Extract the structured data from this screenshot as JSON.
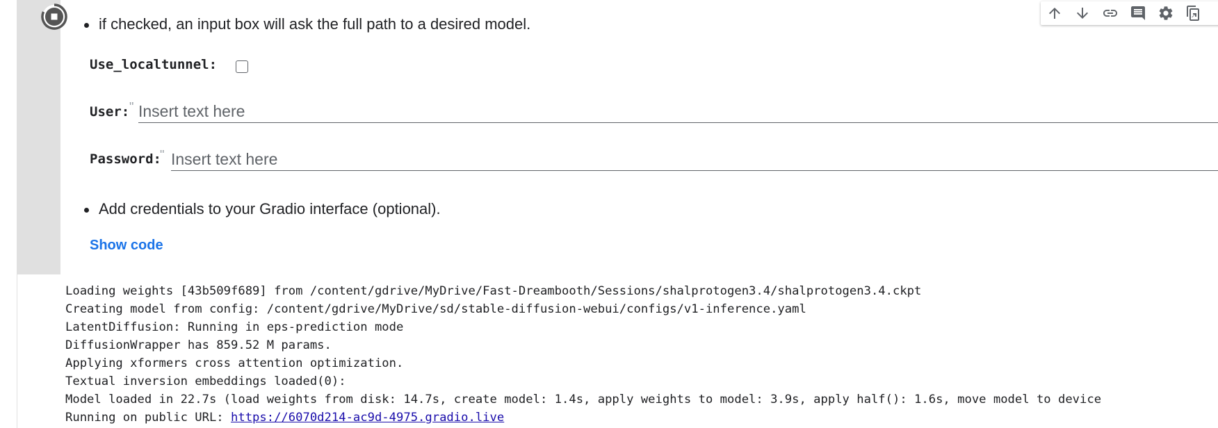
{
  "cell": {
    "bullets": [
      "if checked, an input box will ask the full path to a desired model.",
      "Add credentials to your Gradio interface (optional)."
    ],
    "localtunnel_label": "Use_localtunnel:",
    "localtunnel_checked": false,
    "user_label": "User:",
    "user_placeholder": "Insert text here",
    "user_value": "",
    "password_label": "Password:",
    "password_placeholder": "Insert text here",
    "password_value": "",
    "field_quote": "\"",
    "show_code": "Show code"
  },
  "toolbar": {
    "icons": [
      "arrow-up-icon",
      "arrow-down-icon",
      "link-icon",
      "comment-icon",
      "gear-icon",
      "mirror-cell-icon"
    ]
  },
  "output": {
    "lines": [
      "Loading weights [43b509f689] from /content/gdrive/MyDrive/Fast-Dreambooth/Sessions/shalprotogen3.4/shalprotogen3.4.ckpt",
      "Creating model from config: /content/gdrive/MyDrive/sd/stable-diffusion-webui/configs/v1-inference.yaml",
      "LatentDiffusion: Running in eps-prediction mode",
      "DiffusionWrapper has 859.52 M params.",
      "Applying xformers cross attention optimization.",
      "Textual inversion embeddings loaded(0):",
      "Model loaded in 22.7s (load weights from disk: 14.7s, create model: 1.4s, apply weights to model: 3.9s, apply half(): 1.6s, move model to device"
    ],
    "public_url_prefix": "Running on public URL: ",
    "public_url": "https://6070d214-ac9d-4975.gradio.live"
  },
  "colors": {
    "gutter": "#e0e0e0",
    "link": "#1a73e8",
    "output_link": "#1a0dab"
  }
}
